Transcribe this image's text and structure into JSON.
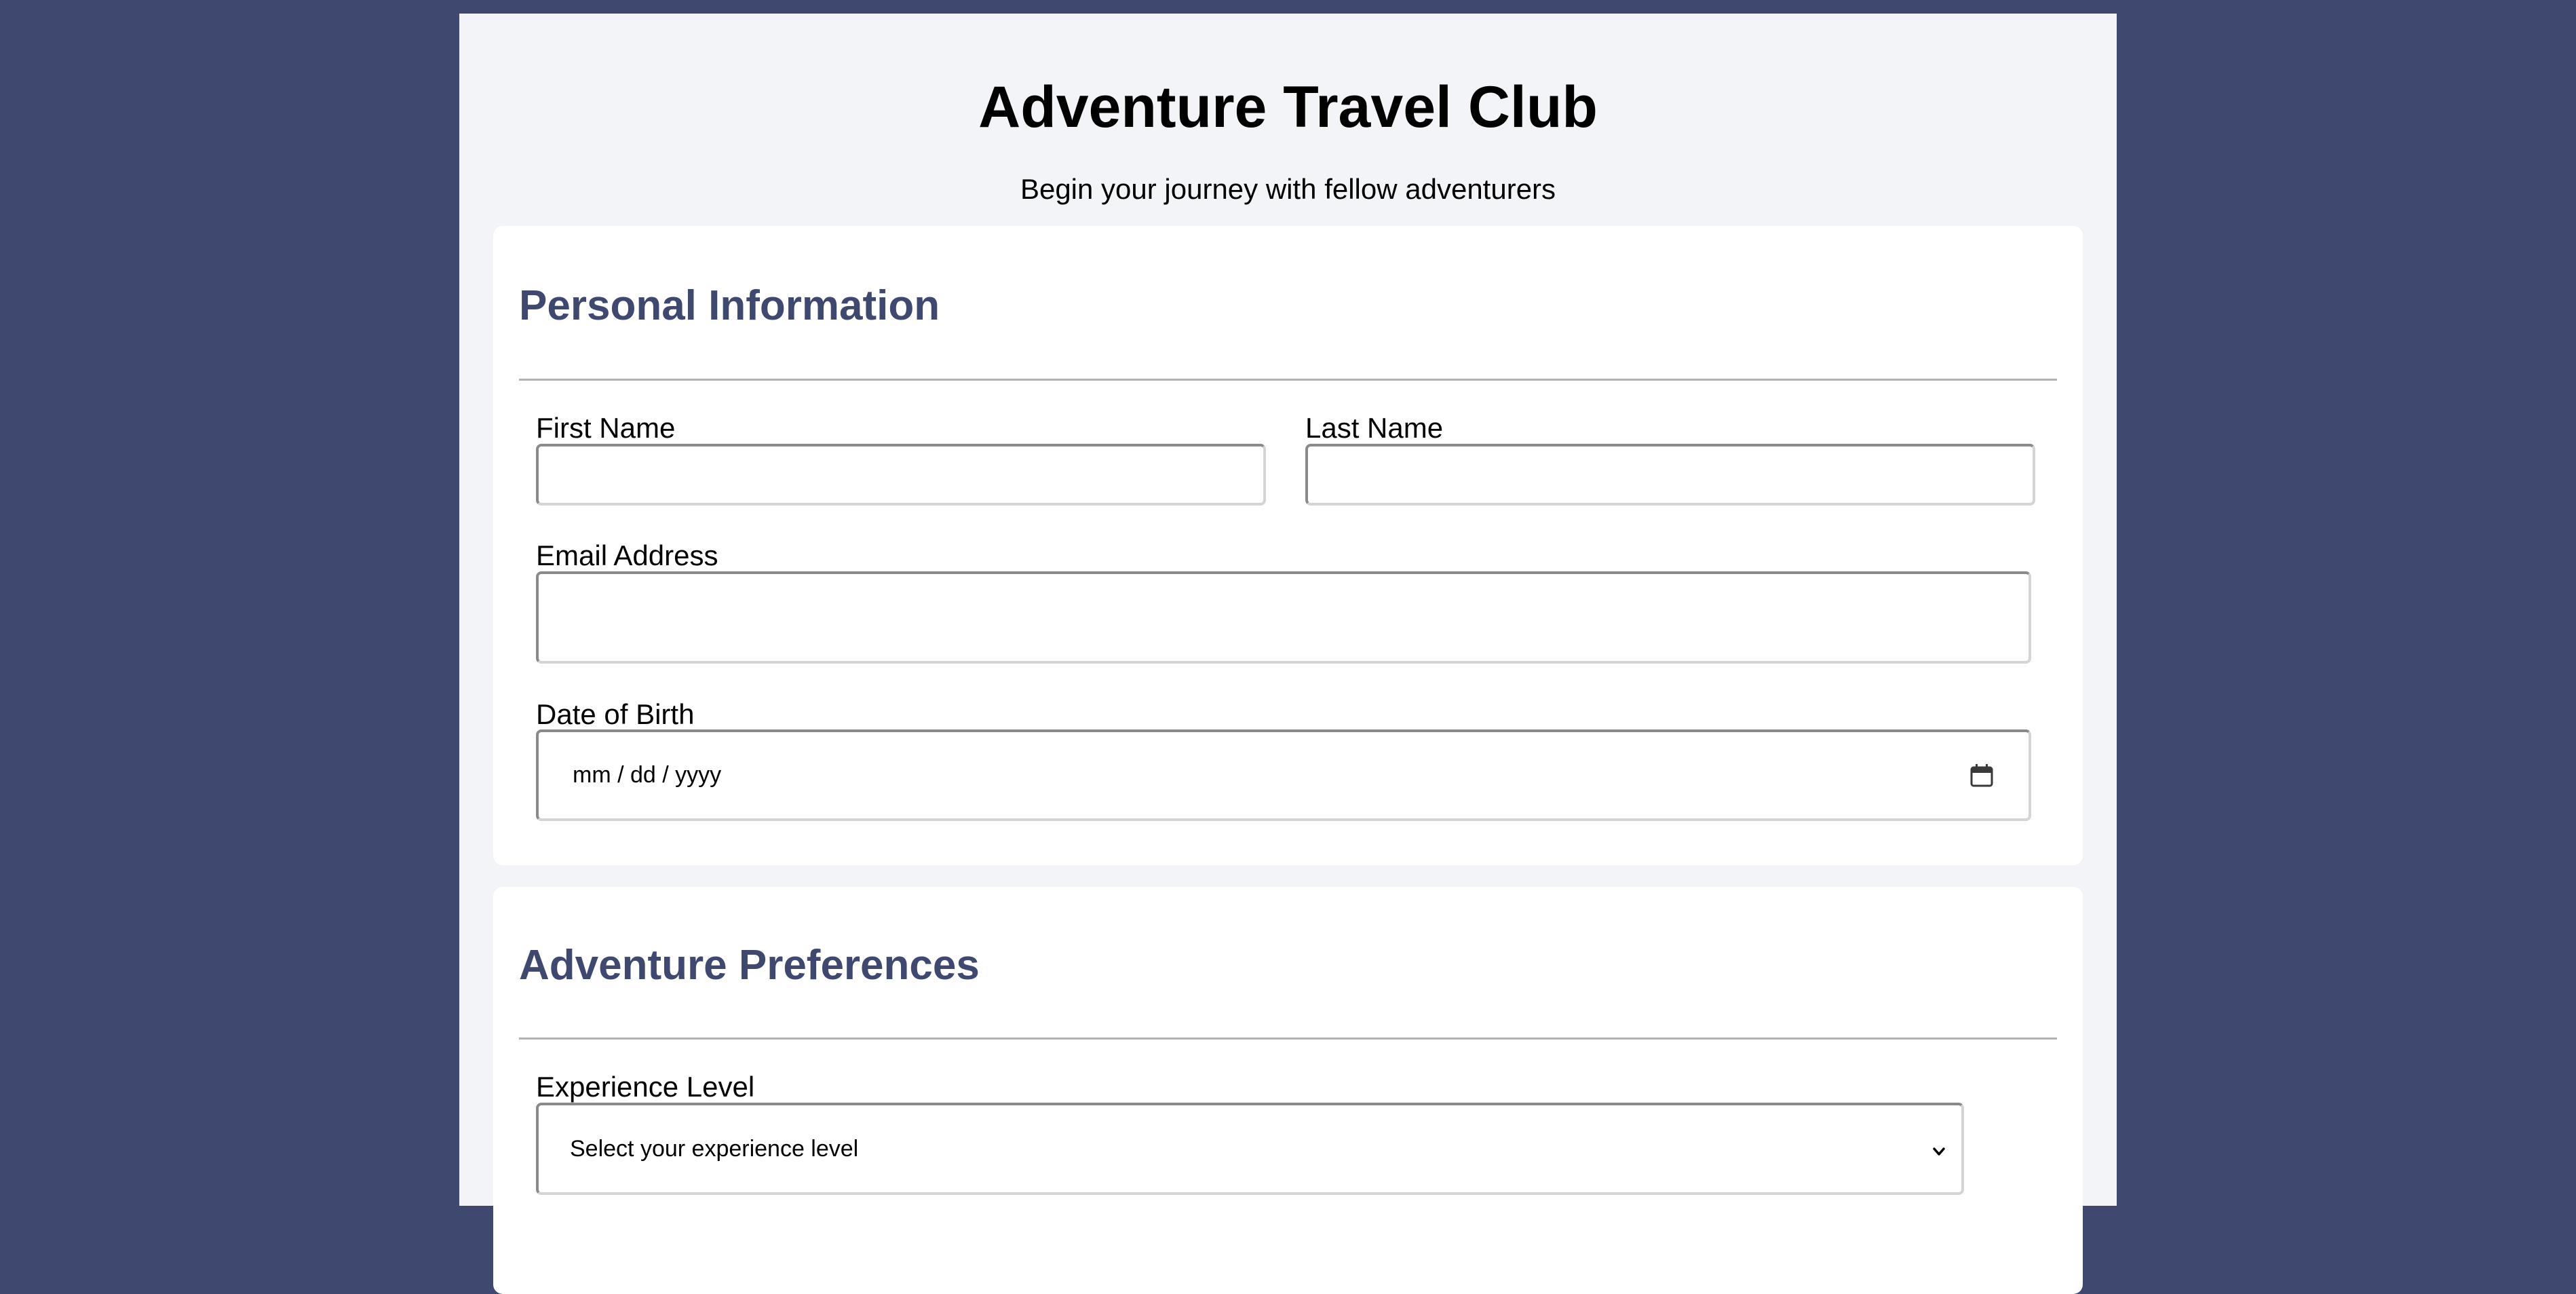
{
  "header": {
    "title": "Adventure Travel Club",
    "subtitle": "Begin your journey with fellow adventurers"
  },
  "personal_info": {
    "section_title": "Personal Information",
    "first_name": {
      "label": "First Name",
      "value": "",
      "placeholder": ""
    },
    "last_name": {
      "label": "Last Name",
      "value": "",
      "placeholder": ""
    },
    "email": {
      "label": "Email Address",
      "value": "",
      "placeholder": ""
    },
    "dob": {
      "label": "Date of Birth",
      "placeholder": "mm / dd / yyyy",
      "icon": "calendar-icon"
    }
  },
  "preferences": {
    "section_title": "Adventure Preferences",
    "experience": {
      "label": "Experience Level",
      "selected": "Select your experience level",
      "icon": "chevron-down-icon"
    }
  },
  "colors": {
    "background": "#3f486e",
    "page": "#f3f4f8",
    "card": "#ffffff",
    "section_title": "#3f486e"
  }
}
